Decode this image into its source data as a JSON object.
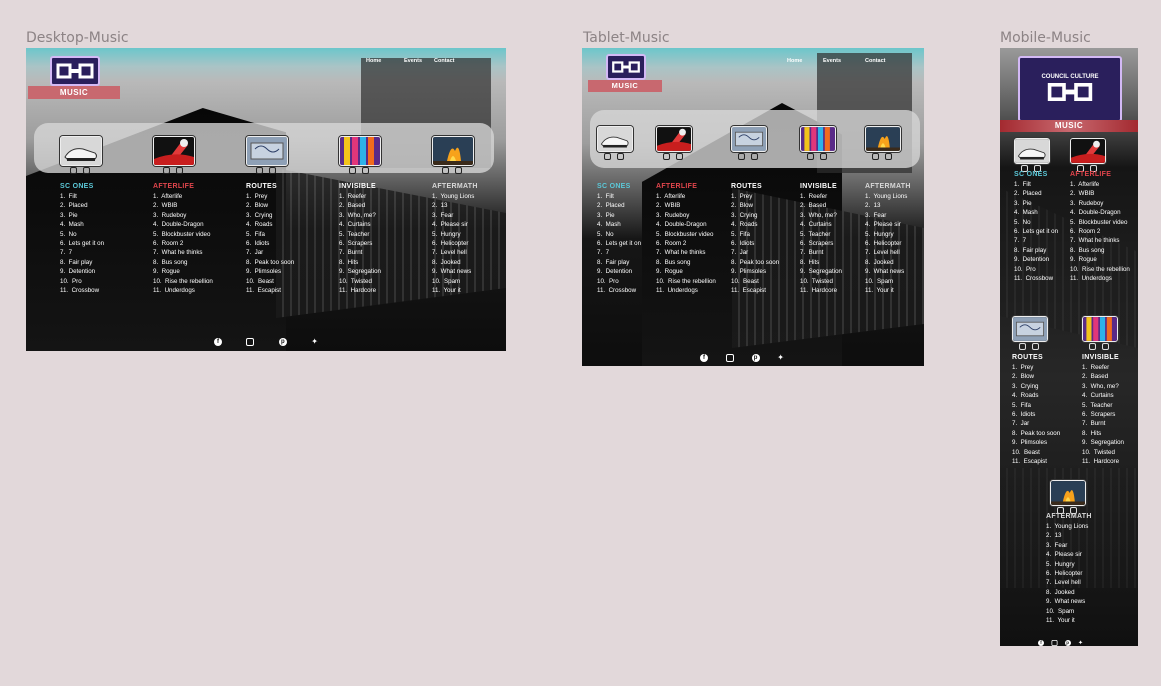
{
  "frames": {
    "desktop": {
      "label": "Desktop-Music"
    },
    "tablet": {
      "label": "Tablet-Music"
    },
    "mobile": {
      "label": "Mobile-Music"
    }
  },
  "logo_text": "COUNCIL CULTURE",
  "page_title": "MUSIC",
  "nav": [
    "Home",
    "Events",
    "Contact"
  ],
  "bands": [
    {
      "name": "SC ONES",
      "color": "#5bc8d8",
      "tracks": [
        "1.  Filt",
        "2.  Placed",
        "3.  Pie",
        "4.  Mash",
        "5.  No",
        "6.  Lets get it on",
        "7.  7",
        "8.  Fair play",
        "9.  Detention",
        "10.  Pro",
        "11.  Crossbow"
      ]
    },
    {
      "name": "AFTERLIFE",
      "color": "#e0454c",
      "tracks": [
        "1.  Afterlife",
        "2.  WBIB",
        "3.  Rudeboy",
        "4.  Double-Dragon",
        "5.  Blockbuster video",
        "6.  Room 2",
        "7.  What he thinks",
        "8.  Bus song",
        "9.  Rogue",
        "10.  Rise the rebellion",
        "11.  Underdogs"
      ]
    },
    {
      "name": "ROUTES",
      "color": "#ffffff",
      "tracks": [
        "1.  Prey",
        "2.  Blow",
        "3.  Crying",
        "4.  Roads",
        "5.  Fifa",
        "6.  Idiots",
        "7.  Jar",
        "8.  Peak too soon",
        "9.  Plimsoles",
        "10.  Beast",
        "11.  Escapist"
      ]
    },
    {
      "name": "INVISIBLE",
      "color": "#ffffff",
      "tracks": [
        "1.  Reefer",
        "2.  Based",
        "3.  Who, me?",
        "4.  Curtains",
        "5.  Teacher",
        "6.  Scrapers",
        "7.  Burnt",
        "8.  Hits",
        "9.  Segregation",
        "10.  Twisted",
        "11.  Hardcore"
      ]
    },
    {
      "name": "AFTERMATH",
      "color": "#d8d8d8",
      "tracks": [
        "1.  Young Lions",
        "2.  13",
        "3.  Fear",
        "4.  Please sir",
        "5.  Hungry",
        "6.  Helicopter",
        "7.  Level hell",
        "8.  Jooked",
        "9.  What news",
        "10.  Spam",
        "11.  Your it"
      ]
    }
  ],
  "thumb_icons": [
    "sneaker-image",
    "paint-splash-image",
    "graffiti-truck-image",
    "colorful-hands-image",
    "fire-image"
  ],
  "footer_icons": [
    "facebook-icon",
    "instagram-icon",
    "pinterest-icon",
    "twitter-icon"
  ],
  "colors": {
    "background": "#e2d8da",
    "accent": "#c8686f",
    "teal": "#5bc8d8",
    "red": "#e0454c"
  }
}
